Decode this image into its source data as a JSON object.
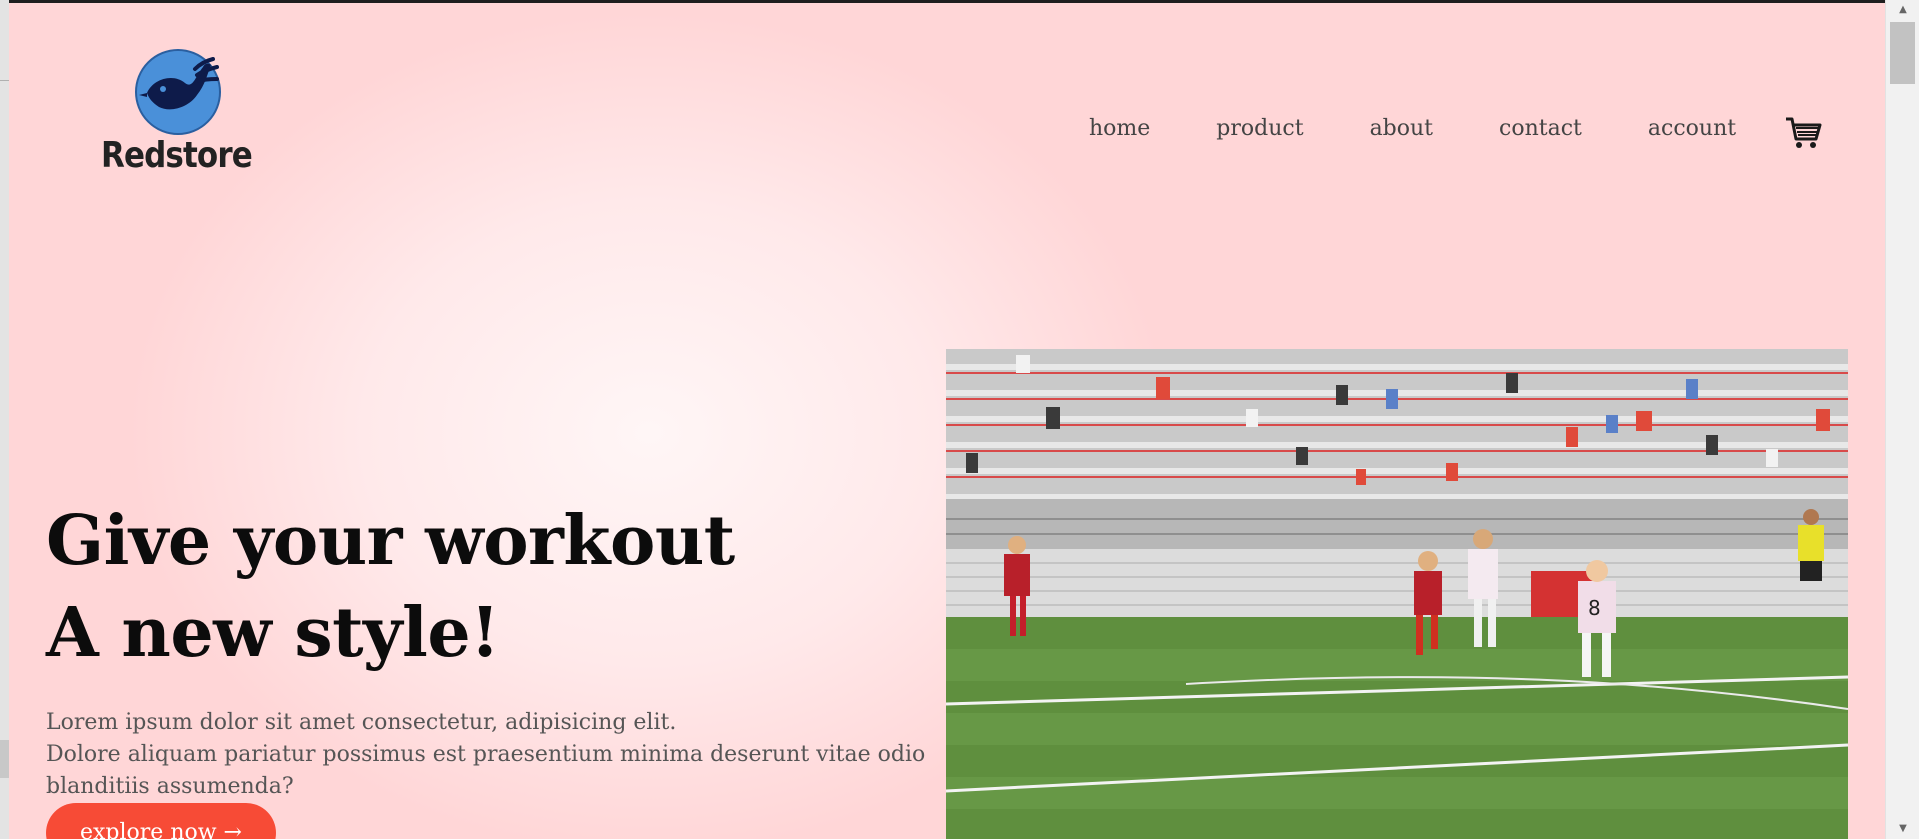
{
  "brand": {
    "name": "Redstore",
    "logo_icon": "bird-icon",
    "logo_color": "#4a90d9"
  },
  "nav": {
    "items": [
      {
        "label": "home"
      },
      {
        "label": "product"
      },
      {
        "label": "about"
      },
      {
        "label": "contact"
      },
      {
        "label": "account"
      }
    ],
    "cart_icon": "cart-icon"
  },
  "hero": {
    "title_line1": "Give your workout",
    "title_line2": "A new style!",
    "text_line1": "Lorem ipsum dolor sit amet consectetur, adipisicing elit.",
    "text_line2": "Dolore aliquam pariatur possimus est praesentium minima deserunt vitae odio blanditiis assumenda?",
    "button_label": "explore now →",
    "image_desc": "soccer-players-image"
  },
  "colors": {
    "background": "#ffd6d7",
    "accent": "#f74b36",
    "title": "#0c0c0c",
    "nav_text": "#444444"
  }
}
